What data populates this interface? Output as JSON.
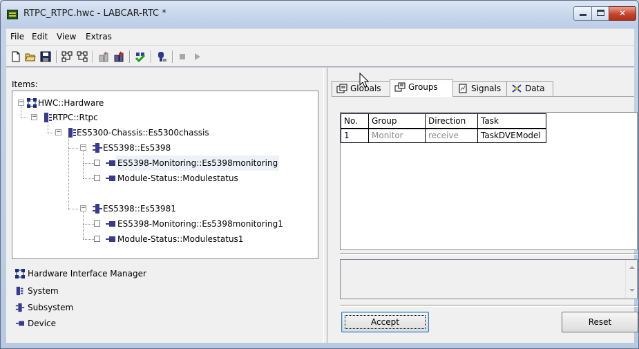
{
  "window": {
    "title": "RTPC_RTPC.hwc - LABCAR-RTC  *"
  },
  "menu": [
    "File",
    "Edit",
    "View",
    "Extras"
  ],
  "toolbar": {
    "icons": [
      "new-file-icon",
      "open-folder-icon",
      "save-icon",
      "add-system-icon",
      "add-subsystem-icon",
      "add-device-icon",
      "add-module-icon",
      "check-icon",
      "build-icon",
      "stop-icon",
      "play-icon"
    ]
  },
  "left": {
    "items_label": "Items:",
    "tree": [
      {
        "label": "HWC::Hardware"
      },
      {
        "label": "RTPC::Rtpc"
      },
      {
        "label": "ES5300-Chassis::Es5300chassis"
      },
      {
        "label": "ES5398::Es5398"
      },
      {
        "label": "ES5398-Monitoring::Es5398monitoring"
      },
      {
        "label": "Module-Status::Modulestatus"
      },
      {
        "label": "ES5398::Es53981"
      },
      {
        "label": "ES5398-Monitoring::Es5398monitoring1"
      },
      {
        "label": "Module-Status::Modulestatus1"
      }
    ],
    "legend": [
      {
        "label": "Hardware Interface Manager",
        "icon": "hardware-manager-icon"
      },
      {
        "label": "System",
        "icon": "system-icon"
      },
      {
        "label": "Subsystem",
        "icon": "subsystem-icon"
      },
      {
        "label": "Device",
        "icon": "device-icon"
      }
    ]
  },
  "tabs": [
    {
      "label": "Globals",
      "icon": "globals-icon"
    },
    {
      "label": "Groups",
      "icon": "groups-icon",
      "active": true
    },
    {
      "label": "Signals",
      "icon": "signals-icon"
    },
    {
      "label": "Data",
      "icon": "data-icon"
    }
  ],
  "groups_table": {
    "headers": [
      "No.",
      "Group",
      "Direction",
      "Task"
    ],
    "rows": [
      [
        "1",
        "Monitor",
        "receive",
        "TaskDVEModel"
      ]
    ]
  },
  "buttons": {
    "accept": "Accept",
    "reset": "Reset"
  }
}
